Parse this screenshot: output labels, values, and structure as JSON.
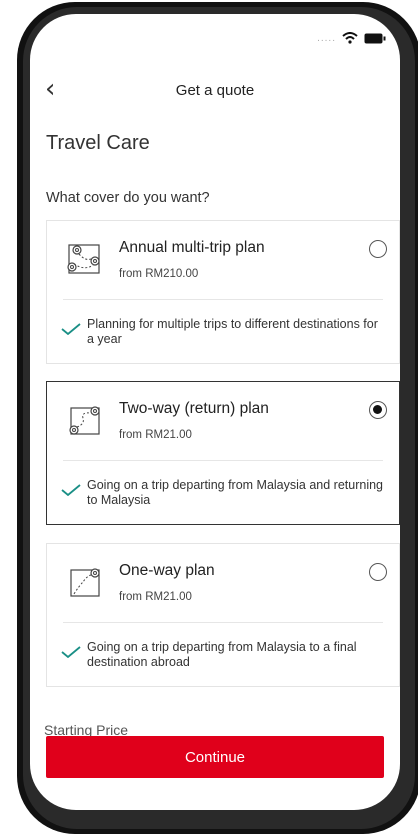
{
  "status": {
    "signal": "....."
  },
  "nav": {
    "back": "‹",
    "title": "Get a quote"
  },
  "page": {
    "heading": "Travel Care",
    "question": "What cover do you want?"
  },
  "plans": [
    {
      "title": "Annual multi-trip plan",
      "price": "from RM210.00",
      "desc": "Planning for multiple trips to different destinations for a year",
      "selected": false
    },
    {
      "title": "Two-way (return) plan",
      "price": "from RM21.00",
      "desc": "Going on a trip departing from Malaysia and returning to Malaysia",
      "selected": true
    },
    {
      "title": "One-way plan",
      "price": "from RM21.00",
      "desc": "Going on a trip departing from Malaysia to a final destination abroad",
      "selected": false
    }
  ],
  "footer": {
    "starting_price_label": "Starting Price",
    "continue": "Continue"
  },
  "colors": {
    "accent": "#e0001b",
    "check": "#1a8f86"
  }
}
